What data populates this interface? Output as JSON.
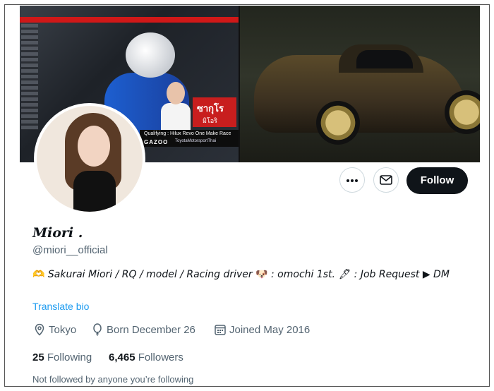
{
  "banner": {
    "name_overlay": "ซากุโร",
    "name_sub": "มิโอริ",
    "caption_line1": "Qualifying : Hilux Revo One Make Race",
    "caption_brand": "GAZOO",
    "caption_social": "ToyotaMotorsportThai"
  },
  "actions": {
    "follow_label": "Follow"
  },
  "profile": {
    "name": "Miori .",
    "handle": "@miori__official",
    "bio_emoji1": "🫶",
    "bio_part1": " Sakurai Miori /  RQ / model / Racing driver ",
    "bio_emoji2": "🐶",
    "bio_part2": " : omochi 1st. ",
    "bio_emoji3": "🖋",
    "bio_part3": " : Job Request ▶ DM",
    "translate_label": "Translate bio",
    "location": "Tokyo",
    "born": "Born December 26",
    "joined": "Joined May 2016",
    "following_count": "25",
    "following_label": " Following",
    "followers_count": "6,465",
    "followers_label": " Followers",
    "not_followed_text": "Not followed by anyone you’re following"
  },
  "icons": {
    "more": "more-dots-icon",
    "message": "envelope-icon",
    "location": "location-pin-icon",
    "born": "balloon-icon",
    "joined": "calendar-icon"
  },
  "colors": {
    "link": "#1d9bf0",
    "muted": "#536471",
    "follow_button": "#0f1419",
    "banner_accent": "#d01818"
  }
}
